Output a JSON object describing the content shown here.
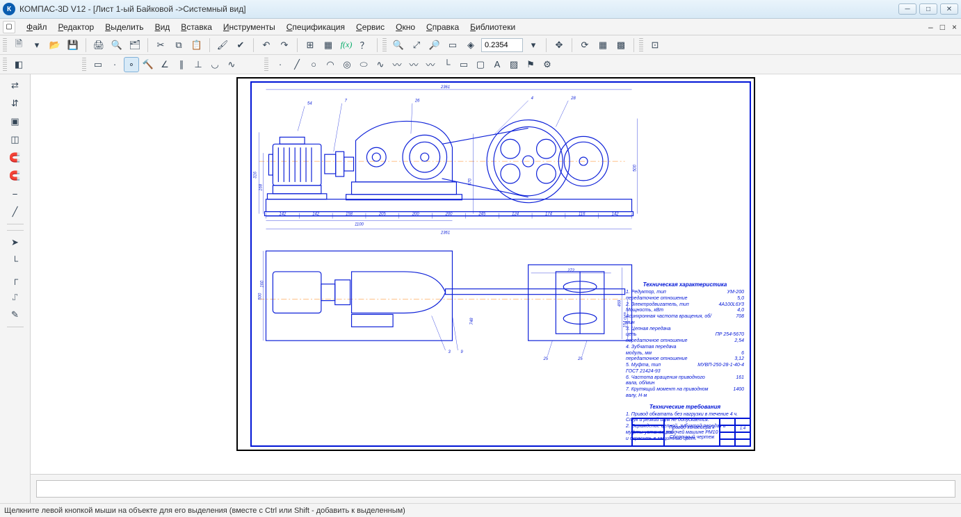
{
  "window": {
    "title": "КОМПАС-3D V12 - [Лист 1-ый Байковой ->Системный вид]",
    "app_icon_text": "К"
  },
  "menu": {
    "items": [
      "Файл",
      "Редактор",
      "Выделить",
      "Вид",
      "Вставка",
      "Инструменты",
      "Спецификация",
      "Сервис",
      "Окно",
      "Справка",
      "Библиотеки"
    ],
    "mdi_controls": [
      "–",
      "□",
      "×"
    ]
  },
  "toolbar1": {
    "zoom_value": "0.2354",
    "icons": {
      "new": "new-doc-icon",
      "open": "open-icon",
      "save": "save-icon",
      "print": "print-icon",
      "preview": "print-preview-icon",
      "props": "properties-icon",
      "cut": "cut-icon",
      "copy": "copy-icon",
      "paste": "paste-icon",
      "brush": "format-brush-icon",
      "check": "check-icon",
      "undo": "undo-icon",
      "redo": "redo-icon",
      "table": "table-icon",
      "blue": "layers-icon",
      "fx": "fx-icon",
      "help": "help-icon",
      "zoom_in": "zoom-in-icon",
      "zoom_fit": "zoom-fit-icon",
      "zoom_out": "zoom-out-icon",
      "zoom_win": "zoom-window-icon",
      "zoom_sel": "zoom-selection-icon",
      "pan": "pan-icon",
      "regen": "regenerate-icon",
      "redraw1": "redraw-1-icon",
      "redraw2": "redraw-2-icon",
      "grid": "grid-icon"
    }
  },
  "toolbar2": {
    "left_icons": [
      "status-icon"
    ],
    "geom_tools": [
      "select-icon",
      "snap-point-icon",
      "snap-mid-icon",
      "hammer-icon",
      "angle-icon",
      "parallel-icon",
      "perp-icon",
      "fillet-icon",
      "curve-icon"
    ],
    "draw_tools": [
      "point-icon",
      "line-icon",
      "circle-icon",
      "arc-icon",
      "two-circles-icon",
      "ellipse-icon",
      "spline-icon",
      "wave-1-icon",
      "wave-2-icon",
      "wave-3-icon",
      "corner-icon",
      "rect-icon",
      "bucket-icon",
      "text-icon",
      "hatch-icon",
      "ribbon-icon",
      "gear-icon"
    ]
  },
  "left_dock_tools": [
    "aux-1-icon",
    "aux-2-icon",
    "copy-polar-icon",
    "planes-icon",
    "magnet-1-icon",
    "magnet-2-icon",
    "aux-3-icon",
    "aux-4-icon",
    "arrow-tool-icon",
    "axis-tool-icon",
    "step-icon",
    "tangent-icon",
    "pencil-icon"
  ],
  "drawing": {
    "top_dim": "2361",
    "motor_label": "54",
    "coupling_label": "7",
    "gear_label": "26",
    "belt_label": "4",
    "pulley_label": "28",
    "left_h1": "316",
    "left_h2": "168",
    "right_h": "500",
    "mid_h": "570",
    "base_dims": [
      "142",
      "142",
      "158",
      "205",
      "200",
      "200",
      "245",
      "124",
      "174",
      "116",
      "142"
    ],
    "base_total": "1100",
    "base_total2": "2361",
    "plan_w": "500",
    "plan_w2": "272",
    "plan_lead1": "3",
    "plan_lead2": "9",
    "plan_lead3": "748",
    "plan_right1": "469",
    "plan_right2": "154 сут",
    "blv": "160",
    "bl1": "25",
    "bl2": "25"
  },
  "tech": {
    "header1": "Техническая характеристика",
    "lines": [
      {
        "l": "1. Редуктор, тип",
        "r": "УМ-200"
      },
      {
        "l": "   передаточное отношение",
        "r": "5,0"
      },
      {
        "l": "2. Электродвигатель, тип",
        "r": "4А100L6У3"
      },
      {
        "l": "   Мощность, кВт",
        "r": "4,0"
      },
      {
        "l": "   Асинхронная частота вращения, об/мин",
        "r": "708"
      },
      {
        "l": "3. Цепная передача",
        "r": ""
      },
      {
        "l": "   цепь",
        "r": "ПР 254-5670"
      },
      {
        "l": "   передаточное отношение",
        "r": "2,54"
      },
      {
        "l": "4. Зубчатая передача",
        "r": ""
      },
      {
        "l": "   модуль, мм",
        "r": "6"
      },
      {
        "l": "   передаточное отношение",
        "r": "3,12"
      },
      {
        "l": "5. Муфта, тип",
        "r": "МУВП-250-28-1-40-4"
      },
      {
        "l": "   ГОСТ 21424-93",
        "r": ""
      },
      {
        "l": "6. Частота вращения приводного вала, об/мин",
        "r": "161"
      },
      {
        "l": "7. Крутящий момент на приводном валу, Н·м",
        "r": "1400"
      }
    ],
    "header2": "Технические требования",
    "req": [
      "1. Привод обкатать без нагрузки в течение 4 ч.",
      "   Стук и резкий шум не допускается.",
      "2. Ограждение цепной, зубчатой передач и муфты установить",
      "   и окрасить в защитный цвет."
    ]
  },
  "titleblock": {
    "desc": "Привод конвейера к рабочей машине РМ10 Сборочный чертеж",
    "sheet_label": "1:4"
  },
  "status": {
    "text": "Щелкните левой кнопкой мыши на объекте для его выделения (вместе с Ctrl или Shift - добавить к выделенным)"
  }
}
